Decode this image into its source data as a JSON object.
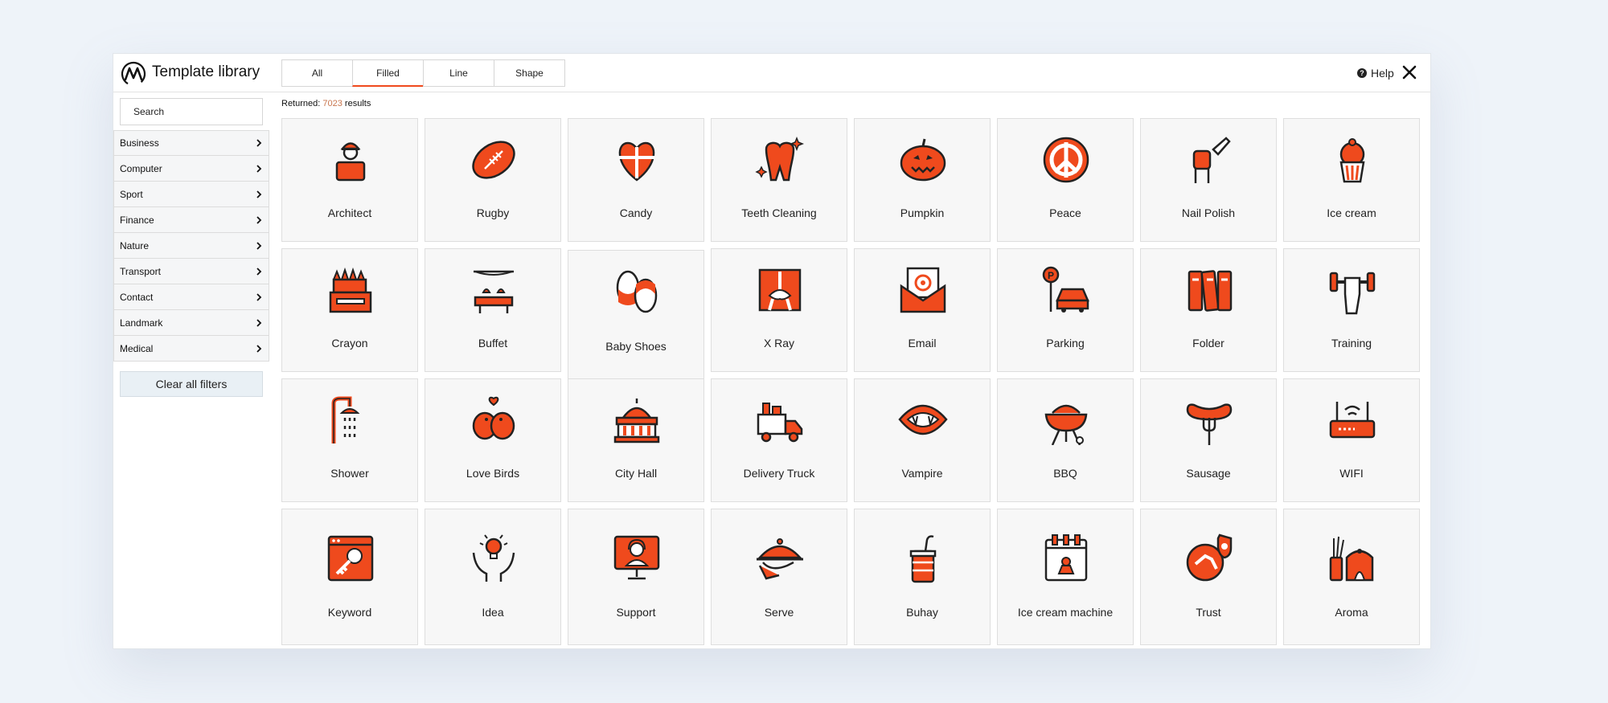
{
  "app": {
    "title": "Template library"
  },
  "tabs": [
    {
      "label": "All",
      "active": false
    },
    {
      "label": "Filled",
      "active": true
    },
    {
      "label": "Line",
      "active": false
    },
    {
      "label": "Shape",
      "active": false
    }
  ],
  "header": {
    "help_label": "Help",
    "help_icon": "question-circle-icon",
    "close_icon": "close-icon"
  },
  "search": {
    "placeholder": "Search"
  },
  "categories": [
    {
      "label": "Business"
    },
    {
      "label": "Computer"
    },
    {
      "label": "Sport"
    },
    {
      "label": "Finance"
    },
    {
      "label": "Nature"
    },
    {
      "label": "Transport"
    },
    {
      "label": "Contact"
    },
    {
      "label": "Landmark"
    },
    {
      "label": "Medical"
    }
  ],
  "clear_filters_label": "Clear all filters",
  "results": {
    "prefix": "Returned:",
    "count": "7023",
    "suffix": "results"
  },
  "colors": {
    "accent": "#ef4a1d",
    "outline": "#222222",
    "count": "#c9774f",
    "card_bg": "#f7f7f7"
  },
  "icons": [
    {
      "label": "Architect",
      "icon": "architect-icon"
    },
    {
      "label": "Rugby",
      "icon": "rugby-ball-icon"
    },
    {
      "label": "Candy",
      "icon": "heart-candy-icon"
    },
    {
      "label": "Teeth Cleaning",
      "icon": "tooth-sparkle-icon"
    },
    {
      "label": "Pumpkin",
      "icon": "pumpkin-icon"
    },
    {
      "label": "Peace",
      "icon": "peace-sign-icon"
    },
    {
      "label": "Nail Polish",
      "icon": "nail-polish-icon"
    },
    {
      "label": "Ice cream",
      "icon": "ice-cream-icon"
    },
    {
      "label": "Crayon",
      "icon": "crayon-box-icon"
    },
    {
      "label": "Buffet",
      "icon": "buffet-icon"
    },
    {
      "label": "Baby Shoes",
      "icon": "baby-shoes-icon"
    },
    {
      "label": "X Ray",
      "icon": "x-ray-icon"
    },
    {
      "label": "Email",
      "icon": "email-envelope-icon"
    },
    {
      "label": "Parking",
      "icon": "parking-car-icon"
    },
    {
      "label": "Folder",
      "icon": "binders-icon"
    },
    {
      "label": "Training",
      "icon": "dumbbell-hand-icon"
    },
    {
      "label": "Shower",
      "icon": "shower-icon"
    },
    {
      "label": "Love Birds",
      "icon": "love-birds-icon"
    },
    {
      "label": "City Hall",
      "icon": "city-hall-icon"
    },
    {
      "label": "Delivery Truck",
      "icon": "delivery-truck-icon"
    },
    {
      "label": "Vampire",
      "icon": "vampire-mouth-icon"
    },
    {
      "label": "BBQ",
      "icon": "bbq-grill-icon"
    },
    {
      "label": "Sausage",
      "icon": "sausage-fork-icon"
    },
    {
      "label": "WIFI",
      "icon": "wifi-router-icon"
    },
    {
      "label": "Keyword",
      "icon": "keyword-key-icon"
    },
    {
      "label": "Idea",
      "icon": "idea-hands-icon"
    },
    {
      "label": "Support",
      "icon": "support-agent-icon"
    },
    {
      "label": "Serve",
      "icon": "serving-cloche-icon"
    },
    {
      "label": "Buhay",
      "icon": "buhay-cup-icon"
    },
    {
      "label": "Ice cream machine",
      "icon": "ice-cream-machine-icon"
    },
    {
      "label": "Trust",
      "icon": "trust-handshake-icon"
    },
    {
      "label": "Aroma",
      "icon": "aroma-diffuser-icon"
    }
  ]
}
